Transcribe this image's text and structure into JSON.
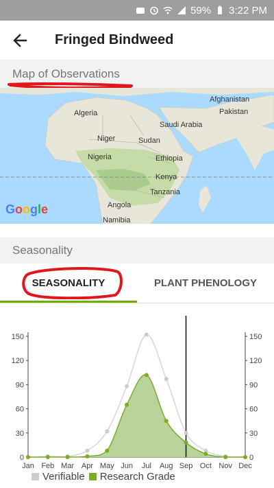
{
  "status_bar": {
    "battery": "59%",
    "time": "3:22 PM"
  },
  "app_bar": {
    "title": "Fringed Bindweed"
  },
  "map_section": {
    "header": "Map of Observations",
    "attribution": "Google",
    "labels": [
      "Algeria",
      "Niger",
      "Sudan",
      "Nigeria",
      "Ethiopia",
      "Kenya",
      "Tanzania",
      "Angola",
      "Namibia",
      "Saudi Arabia",
      "Afghanistan",
      "Pakistan"
    ]
  },
  "seasonality_section": {
    "header": "Seasonality",
    "tabs": [
      {
        "label": "SEASONALITY",
        "active": true
      },
      {
        "label": "PLANT PHENOLOGY",
        "active": false
      }
    ]
  },
  "colors": {
    "accent": "#74ac00",
    "verifiable": "#cccccc",
    "research": "#7cab28",
    "area": "#b8d49a"
  },
  "chart_data": {
    "type": "line",
    "categories": [
      "Jan",
      "Feb",
      "Mar",
      "Apr",
      "May",
      "Jun",
      "Jul",
      "Aug",
      "Sep",
      "Oct",
      "Nov",
      "Dec"
    ],
    "series": [
      {
        "name": "Verifiable",
        "values": [
          0,
          1,
          1,
          8,
          32,
          88,
          152,
          97,
          30,
          8,
          1,
          0
        ]
      },
      {
        "name": "Research Grade",
        "values": [
          0,
          0,
          0,
          1,
          8,
          65,
          102,
          45,
          18,
          4,
          0,
          0
        ]
      }
    ],
    "ylim": [
      0,
      150
    ],
    "yticks_left": [
      "0",
      "30",
      "60",
      "90",
      "120",
      "150"
    ],
    "yticks_right": [
      "0",
      "30",
      "60",
      "90",
      "120",
      "150"
    ],
    "current_month_marker": "Sep",
    "legend": [
      "Verifiable",
      "Research Grade"
    ],
    "grid": false,
    "legend_position": "bottom"
  }
}
